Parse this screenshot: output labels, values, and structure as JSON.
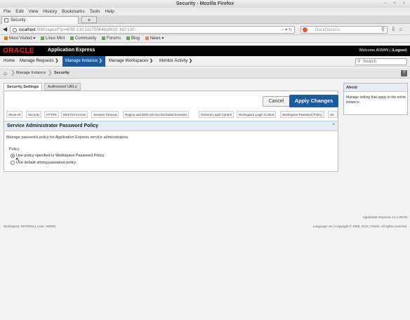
{
  "window": {
    "title": "Security - Mozilla Firefox",
    "controls": "– + ×"
  },
  "menu": [
    "File",
    "Edit",
    "View",
    "History",
    "Bookmarks",
    "Tools",
    "Help"
  ],
  "tab": {
    "label": "Security",
    "new_tab": "+"
  },
  "url": {
    "host": "localhost",
    "path": ":8080/apex/f?p=4050:130:13275564616620::NO:130::",
    "icons": "☆ ▾ ↻"
  },
  "search": {
    "placeholder": "DuckDuckGo"
  },
  "bookmarks": [
    {
      "label": "Most Visited ▾",
      "color": "#d07a1a"
    },
    {
      "label": "Linux Mint",
      "color": "#6aa84f"
    },
    {
      "label": "Community",
      "color": "#6aa84f"
    },
    {
      "label": "Forums",
      "color": "#6aa84f"
    },
    {
      "label": "Blog",
      "color": "#6aa84f"
    },
    {
      "label": "News ▾",
      "color": "#e69138"
    }
  ],
  "apex": {
    "logo": "ORACLE",
    "app_name": "Application Express",
    "welcome_prefix": "Welcome ADMIN",
    "logout": "Logout",
    "nav": [
      "Home",
      "Manage Requests ❯",
      "Manage Instance ❯",
      "Manage Workspaces ❯",
      "Monitor Activity ❯"
    ],
    "search_placeholder": "Search"
  },
  "breadcrumb": {
    "items": [
      "Manage Instance",
      "Security"
    ]
  },
  "main_tabs": [
    "Security Settings",
    "Authorized URLs"
  ],
  "buttons": {
    "cancel": "Cancel",
    "apply": "Apply Changes"
  },
  "sub_tabs": [
    "Show All",
    "Security",
    "HTTPS",
    "RESTful Access",
    "Session Timeout",
    "Region and Web Service Excluded Domains",
    "General Login Control",
    "Workspace Login Control",
    "Workspace Password Policy",
    "Se"
  ],
  "section": {
    "title": "Service Administrator Password Policy",
    "description": "Manage password policy for Application Express service administrators.",
    "policy_label": "Policy",
    "options": [
      {
        "label": "Use policy specified in Workspace Password Policy",
        "checked": true
      },
      {
        "label": "Use default strong password policy",
        "checked": false
      }
    ]
  },
  "about": {
    "title": "About",
    "text": "Manage setting that apply to the entire instance."
  },
  "footer": {
    "version": "Application Express 4.2.1.00.08",
    "left": "Workspace: INTERNAL User: ADMIN",
    "right": "Language: en | Copyright © 1999, 2012, Oracle. All rights reserved."
  },
  "colors": {
    "brand_red": "#e22222",
    "primary_blue": "#1e5aa0"
  }
}
